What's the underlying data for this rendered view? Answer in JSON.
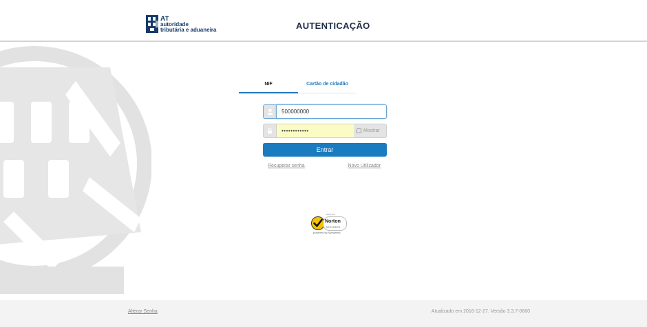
{
  "header": {
    "logo": {
      "line1": "AT",
      "line2": "autoridade",
      "line3": "tributária e aduaneira"
    },
    "title": "AUTENTICAÇÃO"
  },
  "tabs": [
    {
      "label": "NIF",
      "active": true
    },
    {
      "label": "Cartão de cidadão",
      "active": false
    }
  ],
  "form": {
    "nif": {
      "value": "500000000",
      "icon": "user-icon"
    },
    "password": {
      "value": "••••••••••••",
      "icon": "lock-icon"
    },
    "show_label": "Mostrar",
    "submit_label": "Entrar",
    "recover_label": "Recuperar senha",
    "new_user_label": "Novo Utilizador"
  },
  "norton": {
    "verified": "VERIFIED",
    "brand": "Norton",
    "secured": "SECURED",
    "powered": "powered by Symantec"
  },
  "footer": {
    "change_password_label": "Alterar Senha",
    "version_text": "Atualizado em 2016-12-27. Versão 3.3.7-0660"
  },
  "colors": {
    "accent": "#1b7bc1",
    "header_text": "#1f2e46",
    "logo": "#173a6b",
    "autofill": "#fbfbc4"
  }
}
